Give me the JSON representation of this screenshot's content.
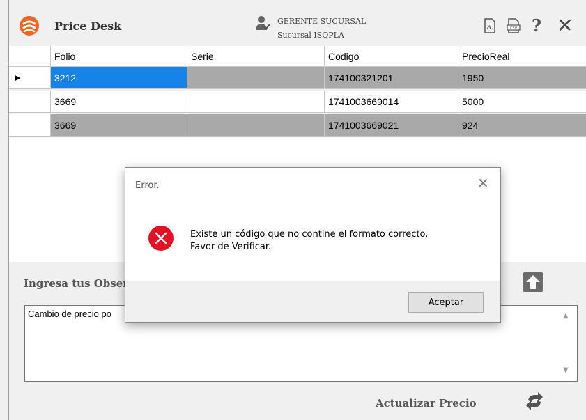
{
  "app": {
    "title": "Price Desk",
    "user_role": "GERENTE SUCURSAL",
    "user_branch": "Sucursal ISQPLA",
    "help_label": "?",
    "close_label": "✕"
  },
  "grid": {
    "columns": [
      "Folio",
      "Serie",
      "Codigo",
      "PrecioReal"
    ],
    "rows": [
      {
        "folio": "3212",
        "serie": "",
        "codigo": "174100321201",
        "precio": "1950"
      },
      {
        "folio": "3669",
        "serie": "",
        "codigo": "1741003669014",
        "precio": "5000"
      },
      {
        "folio": "3669",
        "serie": "",
        "codigo": "1741003669021",
        "precio": "924"
      }
    ],
    "indicator": "▶"
  },
  "observations": {
    "label": "Ingresa tus Obser",
    "value": "Cambio de precio po",
    "scroll_up": "▲",
    "scroll_down": "▼"
  },
  "actions": {
    "update_label": "Actualizar Precio"
  },
  "dialog": {
    "title": "Error.",
    "close_label": "✕",
    "message_line1": "Existe un código que no contine el formato correcto.",
    "message_line2": "Favor de Verificar.",
    "ok_label": "Aceptar"
  },
  "colors": {
    "selection": "#1583e8",
    "row_gray": "#a9a9a9",
    "logo_orange": "#f26522",
    "error_red": "#e81123"
  }
}
